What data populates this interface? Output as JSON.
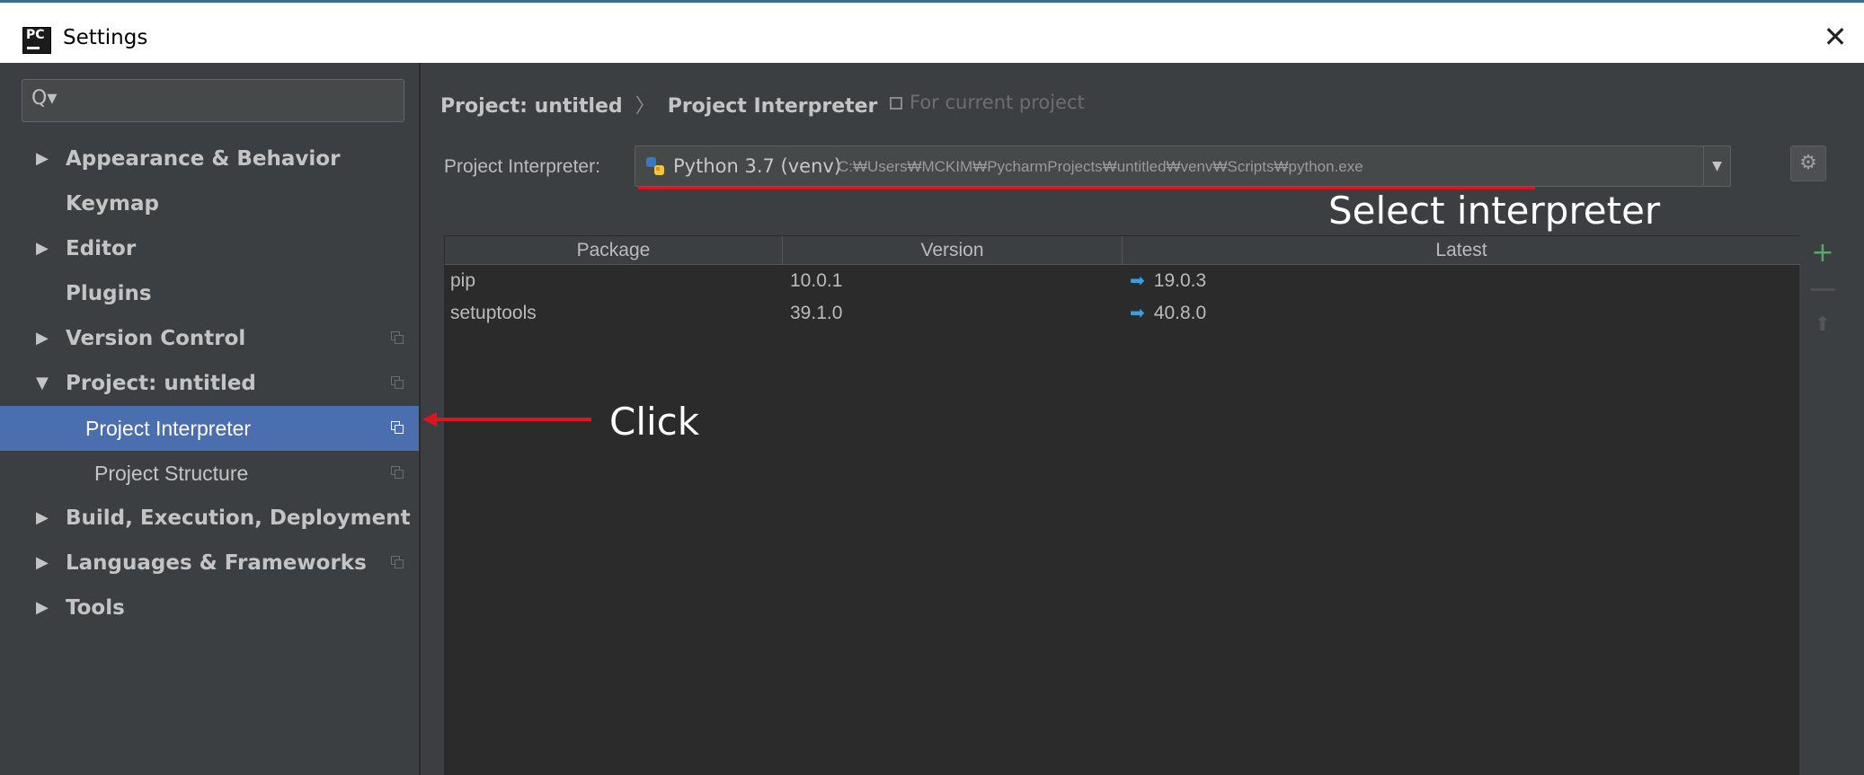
{
  "window": {
    "title": "Settings",
    "close_symbol": "✕",
    "logo_text": "PC"
  },
  "sidebar": {
    "search_icon": "Q▾",
    "items": [
      {
        "label": "Appearance & Behavior",
        "expandable": true,
        "expanded": false,
        "copy_icon": false
      },
      {
        "label": "Keymap",
        "expandable": false,
        "copy_icon": false
      },
      {
        "label": "Editor",
        "expandable": true,
        "expanded": false,
        "copy_icon": false
      },
      {
        "label": "Plugins",
        "expandable": false,
        "copy_icon": false
      },
      {
        "label": "Version Control",
        "expandable": true,
        "expanded": false,
        "copy_icon": true
      },
      {
        "label": "Project: untitled",
        "expandable": true,
        "expanded": true,
        "copy_icon": true
      },
      {
        "label": "Project Interpreter",
        "child": true,
        "selected": true,
        "copy_icon": true
      },
      {
        "label": "Project Structure",
        "child": true,
        "copy_icon": true
      },
      {
        "label": "Build, Execution, Deployment",
        "expandable": true,
        "expanded": false,
        "copy_icon": false
      },
      {
        "label": "Languages & Frameworks",
        "expandable": true,
        "expanded": false,
        "copy_icon": true
      },
      {
        "label": "Tools",
        "expandable": true,
        "expanded": false,
        "copy_icon": false
      }
    ]
  },
  "main": {
    "breadcrumb": {
      "parent": "Project: untitled",
      "separator": "〉",
      "current": "Project Interpreter"
    },
    "scope_note": "For current project",
    "interpreter": {
      "label": "Project Interpreter:",
      "name": "Python 3.7 (venv)",
      "path": "C:₩Users₩MCKIM₩PycharmProjects₩untitled₩venv₩Scripts₩python.exe",
      "dropdown_symbol": "▼",
      "gear_symbol": "⚙"
    },
    "table": {
      "columns": [
        "Package",
        "Version",
        "Latest"
      ],
      "rows": [
        {
          "package": "pip",
          "version": "10.0.1",
          "latest": "19.0.3"
        },
        {
          "package": "setuptools",
          "version": "39.1.0",
          "latest": "40.8.0"
        }
      ],
      "update_arrow_symbol": "➡"
    },
    "tools": {
      "add_symbol": "+",
      "remove_symbol": "—",
      "upgrade_symbol": "⬆"
    }
  },
  "annotations": {
    "select_interpreter": "Select interpreter",
    "click": "Click"
  },
  "colors": {
    "background": "#3c3f41",
    "selection": "#4b6eaf",
    "annotation_red": "#e0141e",
    "add_green": "#59a869",
    "update_blue": "#3d9fe0"
  }
}
